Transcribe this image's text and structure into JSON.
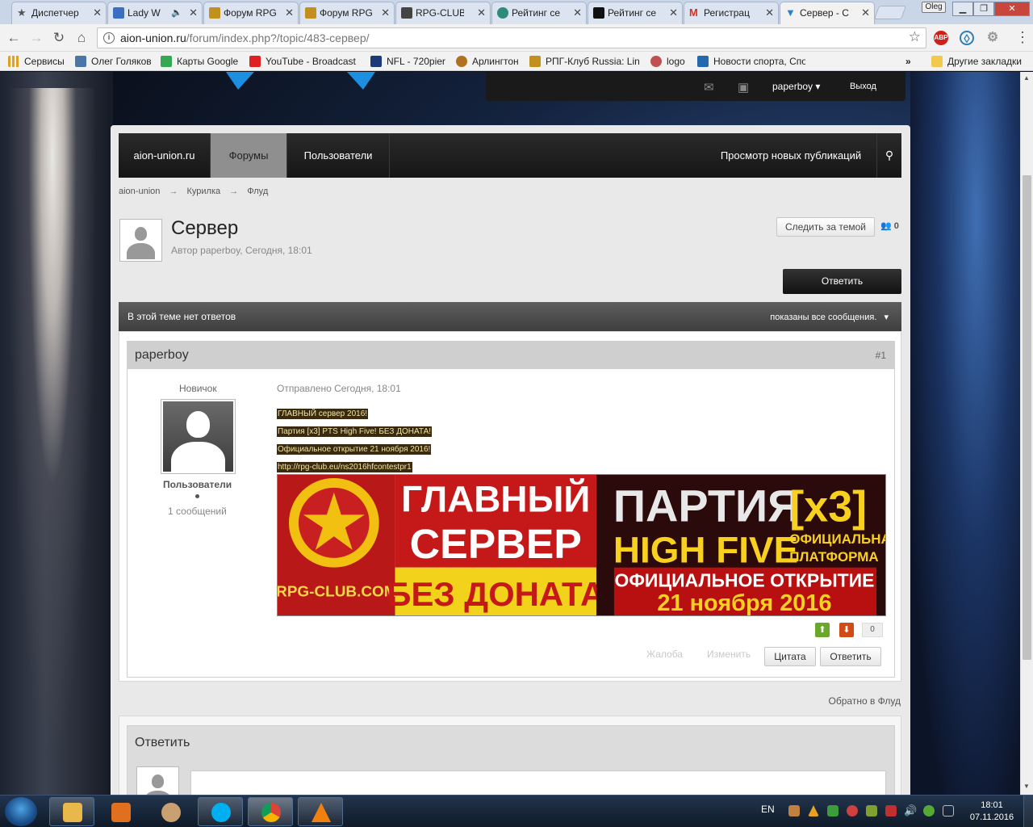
{
  "browser": {
    "tabs": [
      {
        "label": "Диспетчер",
        "color": "#555555"
      },
      {
        "label": "Lady W",
        "color": "#3b6fc1"
      },
      {
        "label": "Форум RPG",
        "color": "#c2901c"
      },
      {
        "label": "Форум RPG",
        "color": "#c2901c"
      },
      {
        "label": "RPG-CLUB",
        "color": "#444444"
      },
      {
        "label": "Рейтинг се",
        "color": "#2e8a7a"
      },
      {
        "label": "Рейтинг се",
        "color": "#111111"
      },
      {
        "label": "Регистрац",
        "color": "#d93025"
      },
      {
        "label": "Сервер - С",
        "color": "#2d7fd1"
      }
    ],
    "user_badge": "Oleg",
    "url_host": "aion-union.ru",
    "url_path": "/forum/index.php?/topic/483-сервер/",
    "extensions": [
      {
        "name": "abp-icon",
        "label": "ABP",
        "color": "#d0201a"
      }
    ],
    "bookmarks": [
      {
        "label": "Сервисы",
        "icon": "apps-icon",
        "color": "#e0a020"
      },
      {
        "label": "Олег Голяков",
        "icon": "vk-icon",
        "color": "#4a76a8"
      },
      {
        "label": "Карты Google",
        "icon": "maps-icon",
        "color": "#34a853"
      },
      {
        "label": "YouTube - Broadcast",
        "icon": "youtube-icon",
        "color": "#e02020"
      },
      {
        "label": "NFL - 720pier",
        "icon": "nfl-icon",
        "color": "#1d3a78"
      },
      {
        "label": "Арлингтон",
        "icon": "arlington-icon",
        "color": "#b07020"
      },
      {
        "label": "РПГ-Клуб Russia: Line",
        "icon": "rpg-icon",
        "color": "#c2901c"
      },
      {
        "label": "logo",
        "icon": "logo-icon",
        "color": "#c05050"
      },
      {
        "label": "Новости спорта, Спо",
        "icon": "sports-icon",
        "color": "#2468b0"
      }
    ],
    "bookmarks_more": "»",
    "other_bookmarks": "Другие закладки"
  },
  "site": {
    "user": "paperboy",
    "logout": "Выход",
    "nav": [
      {
        "label": "aion-union.ru",
        "active": false
      },
      {
        "label": "Форумы",
        "active": true
      },
      {
        "label": "Пользователи",
        "active": false
      }
    ],
    "nav_right": "Просмотр новых публикаций",
    "breadcrumbs": [
      "aion-union",
      "Курилка",
      "Флуд"
    ],
    "breadcrumb_sep": "→"
  },
  "topic": {
    "title": "Сервер",
    "meta": "Автор paperboy, Сегодня, 18:01",
    "follow": "Следить за темой",
    "followers": "0",
    "reply": "Ответить",
    "bar_left": "В этой теме нет ответов",
    "bar_right": "показаны все сообщения."
  },
  "post": {
    "author": "paperboy",
    "number": "#1",
    "rank": "Новичок",
    "group": "Пользователи",
    "count": "1 сообщений",
    "posted": "Отправлено Сегодня, 18:01",
    "lines": [
      "ГЛАВНЫЙ сервер 2016!",
      "Партия [x3] PTS High Five! БЕЗ ДОНАТА!",
      "Официальное открытие 21 ноября 2016!",
      "http://rpg-club.eu/ns2016hfcontestpr1"
    ],
    "banner": {
      "logo_text": "RPG-CLUB.COM",
      "line1": "ГЛАВНЫЙ",
      "line2": "СЕРВЕР",
      "line3": "БЕЗ ДОНАТА",
      "party": "ПАРТИЯ",
      "rate": "[x3]",
      "high_five": "HIGH FIVE",
      "official1": "ОФИЦИАЛЬНАЯ",
      "official2": "ПЛАТФОРМА",
      "opening": "ОФИЦИАЛЬНОЕ ОТКРЫТИЕ",
      "date": "21 ноября 2016"
    },
    "rating": "0",
    "report": "Жалоба",
    "edit": "Изменить",
    "quote": "Цитата",
    "reply": "Ответить"
  },
  "back_link": "Обратно в Флуд",
  "reply_box": {
    "title": "Ответить"
  },
  "taskbar": {
    "apps": [
      {
        "icon": "explorer-icon",
        "color": "#e8b84a"
      },
      {
        "icon": "media-player-icon",
        "color": "#e07020"
      },
      {
        "icon": "paint-icon",
        "color": "#c9a070"
      },
      {
        "icon": "skype-icon",
        "color": "#00aff0"
      },
      {
        "icon": "chrome-icon",
        "color": "#db4437"
      },
      {
        "icon": "vlc-icon",
        "color": "#f08010"
      }
    ],
    "lang": "EN",
    "time": "18:01",
    "date": "07.11.2016",
    "tray": [
      "#c08040",
      "#e8a020",
      "#3c9c3c",
      "#d04040",
      "#80a030",
      "#c03030",
      "#dddddd",
      "#55aa33",
      "#bbbbbb"
    ]
  }
}
